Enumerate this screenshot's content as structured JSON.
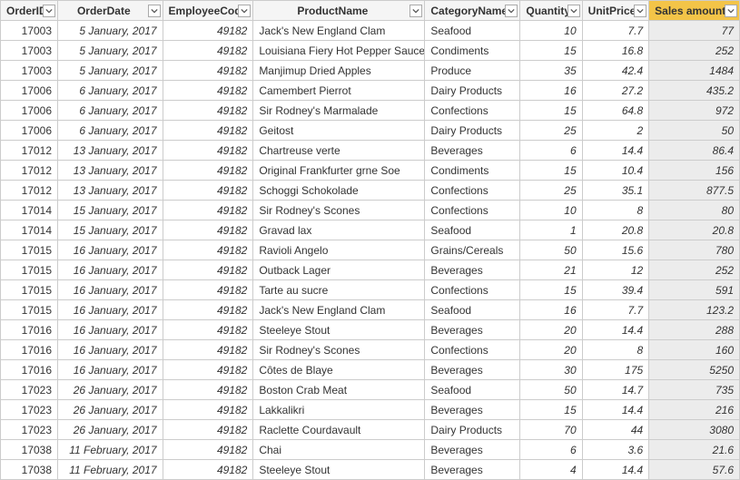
{
  "columns": [
    {
      "key": "OrderID",
      "label": "OrderID",
      "align": "num",
      "italic": false,
      "shade": false,
      "highlight": false,
      "colclass": "c-orderid"
    },
    {
      "key": "OrderDate",
      "label": "OrderDate",
      "align": "num",
      "italic": true,
      "shade": false,
      "highlight": false,
      "colclass": "c-date"
    },
    {
      "key": "EmployeeCode",
      "label": "EmployeeCode",
      "align": "num",
      "italic": true,
      "shade": false,
      "highlight": false,
      "colclass": "c-emp"
    },
    {
      "key": "ProductName",
      "label": "ProductName",
      "align": "txt",
      "italic": false,
      "shade": false,
      "highlight": false,
      "colclass": "c-product"
    },
    {
      "key": "CategoryName",
      "label": "CategoryName",
      "align": "txt",
      "italic": false,
      "shade": false,
      "highlight": false,
      "colclass": "c-category"
    },
    {
      "key": "Quantity",
      "label": "Quantity",
      "align": "num",
      "italic": true,
      "shade": false,
      "highlight": false,
      "colclass": "c-qty"
    },
    {
      "key": "UnitPrice",
      "label": "UnitPrice",
      "align": "num",
      "italic": true,
      "shade": false,
      "highlight": false,
      "colclass": "c-price"
    },
    {
      "key": "SalesAmount",
      "label": "Sales amount",
      "align": "num",
      "italic": true,
      "shade": true,
      "highlight": true,
      "colclass": "c-sales"
    }
  ],
  "rows": [
    {
      "OrderID": "17003",
      "OrderDate": "5 January, 2017",
      "EmployeeCode": "49182",
      "ProductName": "Jack's New England Clam",
      "CategoryName": "Seafood",
      "Quantity": "10",
      "UnitPrice": "7.7",
      "SalesAmount": "77"
    },
    {
      "OrderID": "17003",
      "OrderDate": "5 January, 2017",
      "EmployeeCode": "49182",
      "ProductName": "Louisiana Fiery Hot Pepper Sauce",
      "CategoryName": "Condiments",
      "Quantity": "15",
      "UnitPrice": "16.8",
      "SalesAmount": "252"
    },
    {
      "OrderID": "17003",
      "OrderDate": "5 January, 2017",
      "EmployeeCode": "49182",
      "ProductName": "Manjimup Dried Apples",
      "CategoryName": "Produce",
      "Quantity": "35",
      "UnitPrice": "42.4",
      "SalesAmount": "1484"
    },
    {
      "OrderID": "17006",
      "OrderDate": "6 January, 2017",
      "EmployeeCode": "49182",
      "ProductName": "Camembert Pierrot",
      "CategoryName": "Dairy Products",
      "Quantity": "16",
      "UnitPrice": "27.2",
      "SalesAmount": "435.2"
    },
    {
      "OrderID": "17006",
      "OrderDate": "6 January, 2017",
      "EmployeeCode": "49182",
      "ProductName": "Sir Rodney's Marmalade",
      "CategoryName": "Confections",
      "Quantity": "15",
      "UnitPrice": "64.8",
      "SalesAmount": "972"
    },
    {
      "OrderID": "17006",
      "OrderDate": "6 January, 2017",
      "EmployeeCode": "49182",
      "ProductName": "Geitost",
      "CategoryName": "Dairy Products",
      "Quantity": "25",
      "UnitPrice": "2",
      "SalesAmount": "50"
    },
    {
      "OrderID": "17012",
      "OrderDate": "13 January, 2017",
      "EmployeeCode": "49182",
      "ProductName": "Chartreuse verte",
      "CategoryName": "Beverages",
      "Quantity": "6",
      "UnitPrice": "14.4",
      "SalesAmount": "86.4"
    },
    {
      "OrderID": "17012",
      "OrderDate": "13 January, 2017",
      "EmployeeCode": "49182",
      "ProductName": "Original Frankfurter grne Soe",
      "CategoryName": "Condiments",
      "Quantity": "15",
      "UnitPrice": "10.4",
      "SalesAmount": "156"
    },
    {
      "OrderID": "17012",
      "OrderDate": "13 January, 2017",
      "EmployeeCode": "49182",
      "ProductName": "Schoggi Schokolade",
      "CategoryName": "Confections",
      "Quantity": "25",
      "UnitPrice": "35.1",
      "SalesAmount": "877.5"
    },
    {
      "OrderID": "17014",
      "OrderDate": "15 January, 2017",
      "EmployeeCode": "49182",
      "ProductName": "Sir Rodney's Scones",
      "CategoryName": "Confections",
      "Quantity": "10",
      "UnitPrice": "8",
      "SalesAmount": "80"
    },
    {
      "OrderID": "17014",
      "OrderDate": "15 January, 2017",
      "EmployeeCode": "49182",
      "ProductName": "Gravad lax",
      "CategoryName": "Seafood",
      "Quantity": "1",
      "UnitPrice": "20.8",
      "SalesAmount": "20.8"
    },
    {
      "OrderID": "17015",
      "OrderDate": "16 January, 2017",
      "EmployeeCode": "49182",
      "ProductName": "Ravioli Angelo",
      "CategoryName": "Grains/Cereals",
      "Quantity": "50",
      "UnitPrice": "15.6",
      "SalesAmount": "780"
    },
    {
      "OrderID": "17015",
      "OrderDate": "16 January, 2017",
      "EmployeeCode": "49182",
      "ProductName": "Outback Lager",
      "CategoryName": "Beverages",
      "Quantity": "21",
      "UnitPrice": "12",
      "SalesAmount": "252"
    },
    {
      "OrderID": "17015",
      "OrderDate": "16 January, 2017",
      "EmployeeCode": "49182",
      "ProductName": "Tarte au sucre",
      "CategoryName": "Confections",
      "Quantity": "15",
      "UnitPrice": "39.4",
      "SalesAmount": "591"
    },
    {
      "OrderID": "17015",
      "OrderDate": "16 January, 2017",
      "EmployeeCode": "49182",
      "ProductName": "Jack's New England Clam",
      "CategoryName": "Seafood",
      "Quantity": "16",
      "UnitPrice": "7.7",
      "SalesAmount": "123.2"
    },
    {
      "OrderID": "17016",
      "OrderDate": "16 January, 2017",
      "EmployeeCode": "49182",
      "ProductName": "Steeleye Stout",
      "CategoryName": "Beverages",
      "Quantity": "20",
      "UnitPrice": "14.4",
      "SalesAmount": "288"
    },
    {
      "OrderID": "17016",
      "OrderDate": "16 January, 2017",
      "EmployeeCode": "49182",
      "ProductName": "Sir Rodney's Scones",
      "CategoryName": "Confections",
      "Quantity": "20",
      "UnitPrice": "8",
      "SalesAmount": "160"
    },
    {
      "OrderID": "17016",
      "OrderDate": "16 January, 2017",
      "EmployeeCode": "49182",
      "ProductName": "Côtes de Blaye",
      "CategoryName": "Beverages",
      "Quantity": "30",
      "UnitPrice": "175",
      "SalesAmount": "5250"
    },
    {
      "OrderID": "17023",
      "OrderDate": "26 January, 2017",
      "EmployeeCode": "49182",
      "ProductName": "Boston Crab Meat",
      "CategoryName": "Seafood",
      "Quantity": "50",
      "UnitPrice": "14.7",
      "SalesAmount": "735"
    },
    {
      "OrderID": "17023",
      "OrderDate": "26 January, 2017",
      "EmployeeCode": "49182",
      "ProductName": "Lakkalikri",
      "CategoryName": "Beverages",
      "Quantity": "15",
      "UnitPrice": "14.4",
      "SalesAmount": "216"
    },
    {
      "OrderID": "17023",
      "OrderDate": "26 January, 2017",
      "EmployeeCode": "49182",
      "ProductName": "Raclette Courdavault",
      "CategoryName": "Dairy Products",
      "Quantity": "70",
      "UnitPrice": "44",
      "SalesAmount": "3080"
    },
    {
      "OrderID": "17038",
      "OrderDate": "11 February, 2017",
      "EmployeeCode": "49182",
      "ProductName": "Chai",
      "CategoryName": "Beverages",
      "Quantity": "6",
      "UnitPrice": "3.6",
      "SalesAmount": "21.6"
    },
    {
      "OrderID": "17038",
      "OrderDate": "11 February, 2017",
      "EmployeeCode": "49182",
      "ProductName": "Steeleye Stout",
      "CategoryName": "Beverages",
      "Quantity": "4",
      "UnitPrice": "14.4",
      "SalesAmount": "57.6"
    }
  ]
}
